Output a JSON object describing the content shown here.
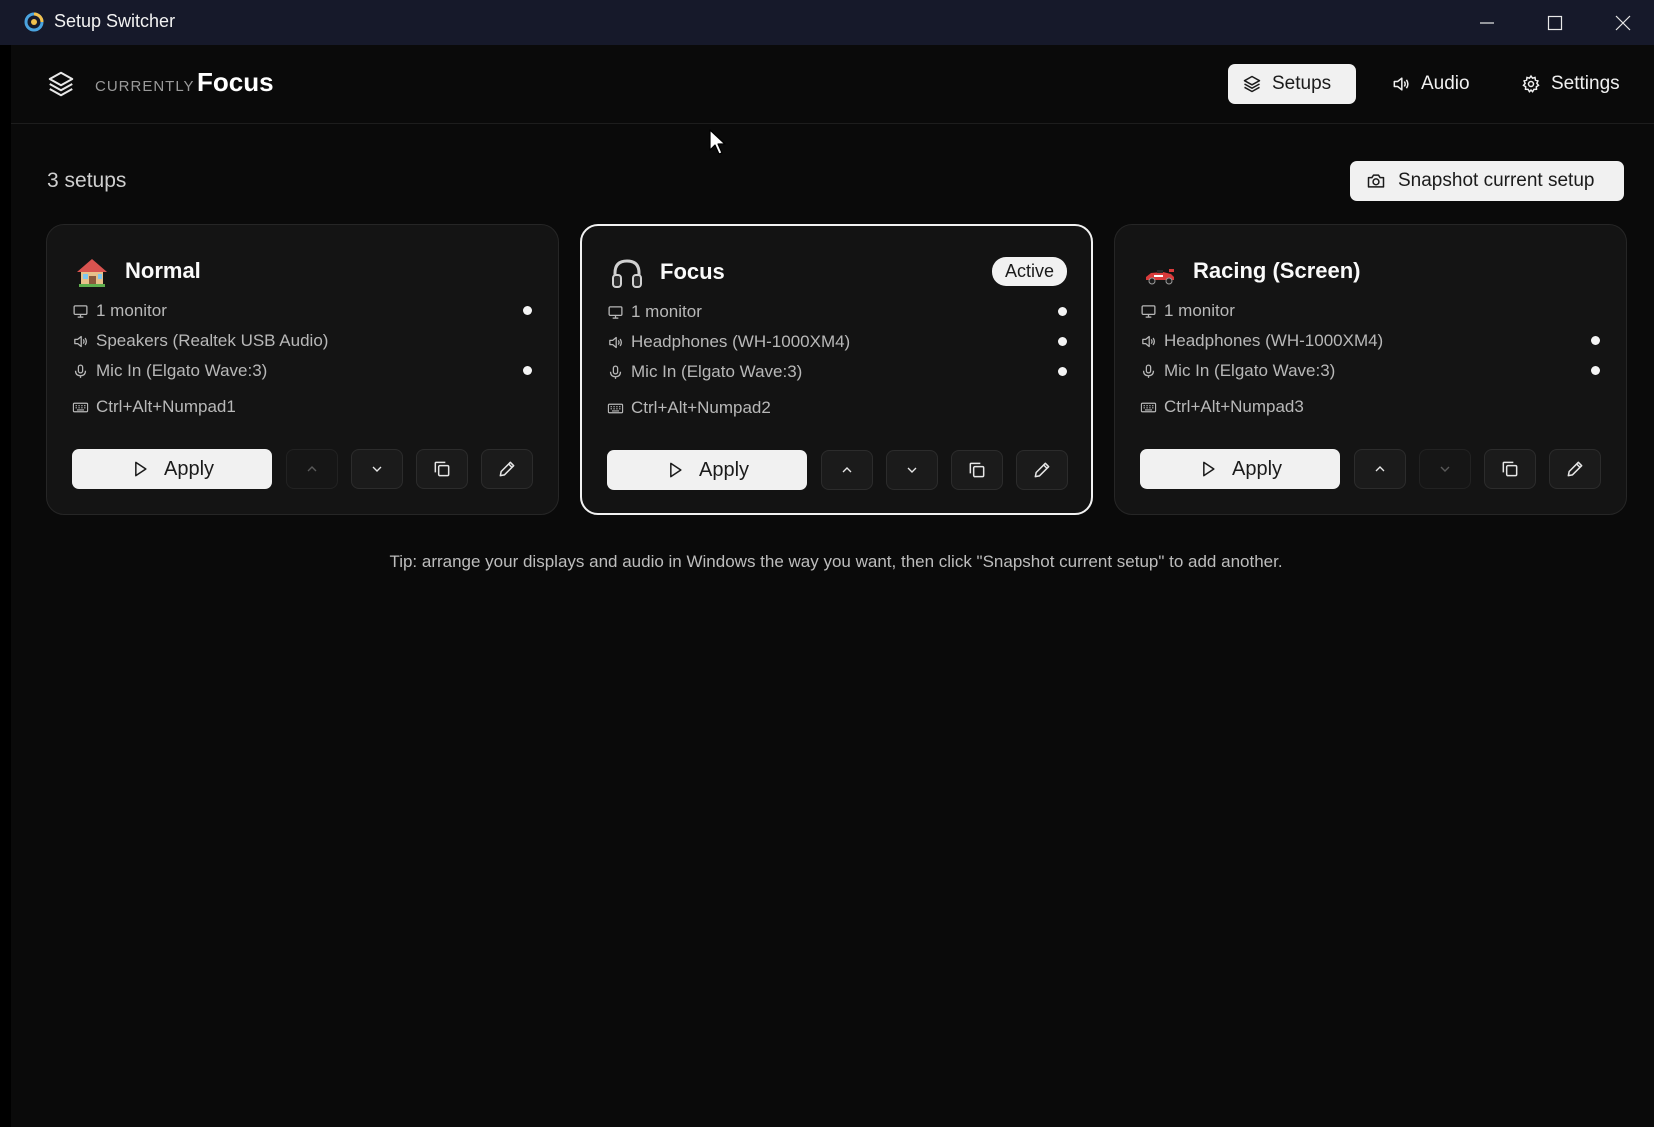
{
  "window": {
    "title": "Setup Switcher"
  },
  "header": {
    "currently_label": "CURRENTLY",
    "current_setup": "Focus",
    "nav": [
      {
        "label": "Setups",
        "icon": "layers-icon",
        "active": true
      },
      {
        "label": "Audio",
        "icon": "speaker-icon",
        "active": false
      },
      {
        "label": "Settings",
        "icon": "gear-icon",
        "active": false
      }
    ]
  },
  "toolbar": {
    "setup_count": "3 setups",
    "snapshot_label": "Snapshot current setup"
  },
  "cards": [
    {
      "name": "Normal",
      "emoji": "house-icon",
      "active": false,
      "monitor": "1 monitor",
      "speaker": "Speakers (Realtek USB Audio)",
      "mic": "Mic In (Elgato Wave:3)",
      "hotkey": "Ctrl+Alt+Numpad1",
      "apply_label": "Apply",
      "up_enabled": false,
      "down_enabled": true
    },
    {
      "name": "Focus",
      "emoji": "headphones-icon",
      "active": true,
      "active_label": "Active",
      "monitor": "1 monitor",
      "speaker": "Headphones (WH-1000XM4)",
      "mic": "Mic In (Elgato Wave:3)",
      "hotkey": "Ctrl+Alt+Numpad2",
      "apply_label": "Apply",
      "up_enabled": true,
      "down_enabled": true
    },
    {
      "name": "Racing (Screen)",
      "emoji": "race-car-icon",
      "active": false,
      "monitor": "1 monitor",
      "speaker": "Headphones (WH-1000XM4)",
      "mic": "Mic In (Elgato Wave:3)",
      "hotkey": "Ctrl+Alt+Numpad3",
      "apply_label": "Apply",
      "up_enabled": true,
      "down_enabled": false
    }
  ],
  "tip": "Tip: arrange your displays and audio in Windows the way you want, then click \"Snapshot current setup\" to add another.",
  "colors": {
    "background": "#0a0a0a",
    "titlebar": "#16192a",
    "card": "#141414",
    "accent_light": "#f1f1f1"
  }
}
